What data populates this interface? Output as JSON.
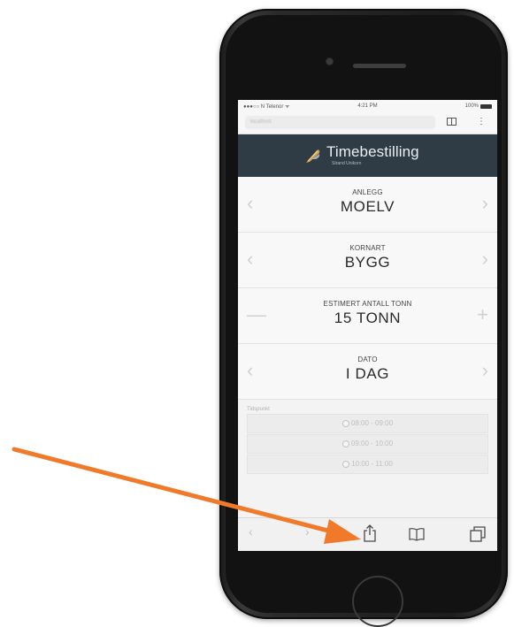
{
  "status": {
    "carrier": "●●●○○ N Telenor ᯤ",
    "time": "4:21 PM",
    "battery": "100%"
  },
  "browser": {
    "url": "localhost"
  },
  "header": {
    "title": "Timebestilling",
    "subtitle": "Strand Unikorn"
  },
  "fields": [
    {
      "label": "ANLEGG",
      "value": "MOELV",
      "left": "‹",
      "right": "›"
    },
    {
      "label": "KORNART",
      "value": "BYGG",
      "left": "‹",
      "right": "›"
    },
    {
      "label": "ESTIMERT ANTALL TONN",
      "value": "15 TONN",
      "left": "—",
      "right": "+"
    },
    {
      "label": "DATO",
      "value": "I DAG",
      "left": "‹",
      "right": "›"
    }
  ],
  "timeslots": {
    "label": "Tidspunkt",
    "items": [
      "08:00 - 09:00",
      "09:00 - 10:00",
      "10:00 - 11:00"
    ]
  },
  "toolbar": {
    "back": "‹",
    "forward": "›"
  },
  "colors": {
    "header_bg": "#2f3b45",
    "arrow": "#f07a2a"
  }
}
